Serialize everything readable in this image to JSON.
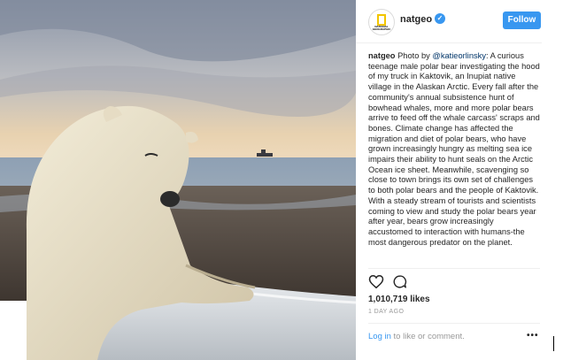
{
  "post": {
    "username": "natgeo",
    "avatar_logo_text": "NATIONAL GEOGRAPHIC",
    "verified_icon": "checkmark",
    "follow_label": "Follow",
    "caption": {
      "username": "natgeo",
      "prefix": "Photo by",
      "mention": "@katieorlinsky",
      "text": ": A curious teenage male polar bear investigating the hood of my truck in Kaktovik, an Inupiat native village in the Alaskan Arctic. Every fall after the community's annual subsistence hunt of bowhead whales, more and more polar bears arrive to feed off the whale carcass' scraps and bones. Climate change has affected the migration and diet of polar bears, who have grown increasingly hungry as melting sea ice impairs their ability to hunt seals on the Arctic Ocean ice sheet. Meanwhile, scavenging so close to town brings its own set of challenges to both polar bears and the people of Kaktovik. With a steady stream of tourists and scientists coming to view and study the polar bears year after year, bears grow increasingly accustomed to interaction with humans-the most dangerous predator on the planet."
    },
    "likes": "1,010,719 likes",
    "timestamp": "1 DAY AGO",
    "login_link": "Log in",
    "login_rest": "to like or comment.",
    "more_label": "•••"
  },
  "icons": {
    "heart": "heart-outline",
    "comment": "speech-bubble-outline"
  },
  "colors": {
    "accent": "#3897f0",
    "text": "#262626",
    "muted": "#999999"
  }
}
